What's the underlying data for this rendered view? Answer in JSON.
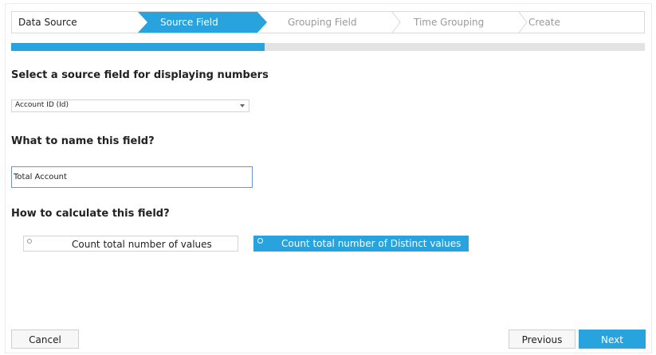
{
  "wizard": {
    "steps": [
      {
        "label": "Data Source",
        "state": "done"
      },
      {
        "label": "Source Field",
        "state": "active"
      },
      {
        "label": "Grouping Field",
        "state": "todo"
      },
      {
        "label": "Time Grouping",
        "state": "todo"
      },
      {
        "label": "Create",
        "state": "todo"
      }
    ],
    "progress_fraction": 0.4
  },
  "source_section": {
    "heading": "Select a source field for displaying numbers",
    "selected_value": "Account ID (Id)"
  },
  "name_section": {
    "heading": "What to name this field?",
    "value": "Total Account"
  },
  "calc_section": {
    "heading": "How to calculate this field?",
    "options": [
      {
        "label": "Count total number of values",
        "selected": false
      },
      {
        "label": "Count total number of Distinct values",
        "selected": true
      }
    ]
  },
  "footer": {
    "cancel_label": "Cancel",
    "previous_label": "Previous",
    "next_label": "Next"
  },
  "colors": {
    "accent": "#29a3dd",
    "muted_text": "#9a9a9a"
  }
}
